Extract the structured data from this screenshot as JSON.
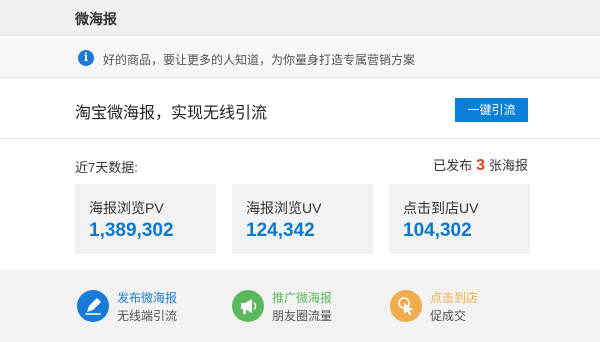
{
  "header": {
    "title": "微海报"
  },
  "info": {
    "icon": "info-icon",
    "glyph": "i",
    "text": "好的商品，要让更多的人知道，为你量身打造专属营销方案"
  },
  "promo": {
    "title": "淘宝微海报，实现无线引流",
    "button_label": "一键引流"
  },
  "stats": {
    "label": "近7天数据:",
    "published_prefix": "已发布",
    "published_count": "3",
    "published_suffix": "张海报",
    "items": [
      {
        "label": "海报浏览PV",
        "value": "1,389,302"
      },
      {
        "label": "海报浏览UV",
        "value": "124,342"
      },
      {
        "label": "点击到店UV",
        "value": "104,302"
      }
    ]
  },
  "features": [
    {
      "title": "发布微海报",
      "subtitle": "无线端引流",
      "icon": "edit-pencil-icon",
      "color": "#1a7bd6"
    },
    {
      "title": "推广微海报",
      "subtitle": "朋友圈流量",
      "icon": "megaphone-icon",
      "color": "#5cb85c"
    },
    {
      "title": "点击到店",
      "subtitle": "促成交",
      "icon": "cursor-click-icon",
      "color": "#f0ad4e"
    }
  ],
  "colors": {
    "accent_blue": "#0a7fd9",
    "stat_value": "#0a78cf",
    "count_red": "#e5401f",
    "green": "#5cb85c",
    "orange": "#f0ad4e"
  }
}
